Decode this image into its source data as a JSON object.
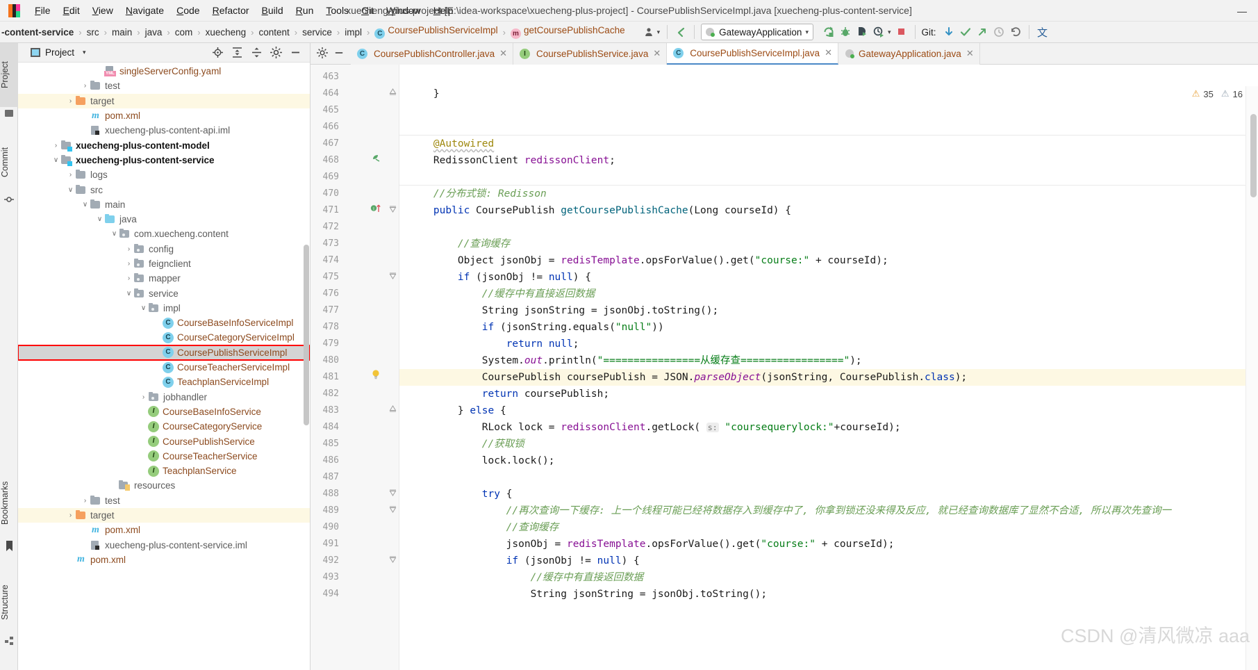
{
  "titlebar": {
    "app_icon": "intellij-logo-icon",
    "title": "xuecheng-plus-project [E:\\idea-workspace\\xuecheng-plus-project] - CoursePublishServiceImpl.java [xuecheng-plus-content-service]",
    "menus": [
      {
        "mnemonic": "F",
        "rest": "ile"
      },
      {
        "mnemonic": "E",
        "rest": "dit"
      },
      {
        "mnemonic": "V",
        "rest": "iew"
      },
      {
        "mnemonic": "N",
        "rest": "avigate"
      },
      {
        "mnemonic": "C",
        "rest": "ode"
      },
      {
        "mnemonic": "R",
        "rest": "efactor"
      },
      {
        "mnemonic": "B",
        "rest": "uild"
      },
      {
        "mnemonic": "R",
        "rest": "un"
      },
      {
        "mnemonic": "T",
        "rest": "ools"
      },
      {
        "mnemonic": "G",
        "rest": "it"
      },
      {
        "mnemonic": "W",
        "rest": "indow"
      },
      {
        "mnemonic": "H",
        "rest": "elp"
      }
    ],
    "minimize_label": "—"
  },
  "navbar": {
    "breadcrumb": [
      {
        "label": "-content-service",
        "kind": "module"
      },
      {
        "label": "src",
        "kind": "dir"
      },
      {
        "label": "main",
        "kind": "dir"
      },
      {
        "label": "java",
        "kind": "dir"
      },
      {
        "label": "com",
        "kind": "dir"
      },
      {
        "label": "xuecheng",
        "kind": "dir"
      },
      {
        "label": "content",
        "kind": "dir"
      },
      {
        "label": "service",
        "kind": "dir"
      },
      {
        "label": "impl",
        "kind": "dir"
      },
      {
        "label": "CoursePublishServiceImpl",
        "kind": "class"
      },
      {
        "label": "getCoursePublishCache",
        "kind": "method"
      }
    ],
    "run_config": "GatewayApplication",
    "git_label": "Git:",
    "icons": {
      "profile": "user-profile-icon",
      "back": "back-arrow-icon",
      "run": "run-icon",
      "debug": "debug-icon",
      "run_with_coverage": "run-coverage-icon",
      "profiler": "profiler-icon",
      "stop": "stop-icon",
      "update_project": "git-update-icon",
      "commit": "git-commit-icon",
      "push": "git-push-icon",
      "history": "git-history-icon",
      "rollback": "git-rollback-icon",
      "translate": "translate-icon"
    }
  },
  "left_strip": {
    "tabs": [
      {
        "label": "Project",
        "active": true,
        "icon": "project-icon"
      },
      {
        "label": "Commit",
        "active": false,
        "icon": "commit-icon"
      },
      {
        "label": "Bookmarks",
        "active": false,
        "icon": "bookmark-icon"
      },
      {
        "label": "Structure",
        "active": false,
        "icon": "structure-icon"
      }
    ]
  },
  "project_panel": {
    "title": "Project",
    "caret": "▾",
    "actions": [
      "locate-target-icon",
      "expand-all-icon",
      "collapse-all-icon",
      "settings-icon",
      "hide-icon"
    ],
    "tree": [
      {
        "indent": 5,
        "arrow": "",
        "icon": "yml-file",
        "label": "singleServerConfig.yaml",
        "style": "file"
      },
      {
        "indent": 4,
        "arrow": "›",
        "icon": "folder-gray",
        "label": "test",
        "style": "dir"
      },
      {
        "indent": 3,
        "arrow": "›",
        "icon": "folder-orange",
        "label": "target",
        "style": "dir",
        "highlight": "target"
      },
      {
        "indent": 4,
        "arrow": "",
        "icon": "maven-m",
        "label": "pom.xml",
        "style": "file"
      },
      {
        "indent": 4,
        "arrow": "",
        "icon": "iml-file",
        "label": "xuecheng-plus-content-api.iml",
        "style": "dirfile"
      },
      {
        "indent": 2,
        "arrow": "›",
        "icon": "folder-module",
        "label": "xuecheng-plus-content-model",
        "style": "module"
      },
      {
        "indent": 2,
        "arrow": "∨",
        "icon": "folder-module",
        "label": "xuecheng-plus-content-service",
        "style": "module"
      },
      {
        "indent": 3,
        "arrow": "›",
        "icon": "folder-gray",
        "label": "logs",
        "style": "dir"
      },
      {
        "indent": 3,
        "arrow": "∨",
        "icon": "folder-gray",
        "label": "src",
        "style": "dir"
      },
      {
        "indent": 4,
        "arrow": "∨",
        "icon": "folder-gray",
        "label": "main",
        "style": "dir"
      },
      {
        "indent": 5,
        "arrow": "∨",
        "icon": "folder-blue",
        "label": "java",
        "style": "dir"
      },
      {
        "indent": 6,
        "arrow": "∨",
        "icon": "folder-pkg",
        "label": "com.xuecheng.content",
        "style": "dir"
      },
      {
        "indent": 7,
        "arrow": "›",
        "icon": "folder-pkg",
        "label": "config",
        "style": "dir"
      },
      {
        "indent": 7,
        "arrow": "›",
        "icon": "folder-pkg",
        "label": "feignclient",
        "style": "dir"
      },
      {
        "indent": 7,
        "arrow": "›",
        "icon": "folder-pkg",
        "label": "mapper",
        "style": "dir"
      },
      {
        "indent": 7,
        "arrow": "∨",
        "icon": "folder-pkg",
        "label": "service",
        "style": "dir"
      },
      {
        "indent": 8,
        "arrow": "∨",
        "icon": "folder-pkg",
        "label": "impl",
        "style": "dir"
      },
      {
        "indent": 9,
        "arrow": "",
        "icon": "java-class",
        "label": "CourseBaseInfoServiceImpl",
        "style": "file"
      },
      {
        "indent": 9,
        "arrow": "",
        "icon": "java-class",
        "label": "CourseCategoryServiceImpl",
        "style": "file"
      },
      {
        "indent": 9,
        "arrow": "",
        "icon": "java-class",
        "label": "CoursePublishServiceImpl",
        "style": "file",
        "selected": true,
        "boxed": true
      },
      {
        "indent": 9,
        "arrow": "",
        "icon": "java-class",
        "label": "CourseTeacherServiceImpl",
        "style": "file"
      },
      {
        "indent": 9,
        "arrow": "",
        "icon": "java-class",
        "label": "TeachplanServiceImpl",
        "style": "file"
      },
      {
        "indent": 8,
        "arrow": "›",
        "icon": "folder-pkg",
        "label": "jobhandler",
        "style": "dir"
      },
      {
        "indent": 8,
        "arrow": "",
        "icon": "java-interface",
        "label": "CourseBaseInfoService",
        "style": "file"
      },
      {
        "indent": 8,
        "arrow": "",
        "icon": "java-interface",
        "label": "CourseCategoryService",
        "style": "file"
      },
      {
        "indent": 8,
        "arrow": "",
        "icon": "java-interface",
        "label": "CoursePublishService",
        "style": "file"
      },
      {
        "indent": 8,
        "arrow": "",
        "icon": "java-interface",
        "label": "CourseTeacherService",
        "style": "file"
      },
      {
        "indent": 8,
        "arrow": "",
        "icon": "java-interface",
        "label": "TeachplanService",
        "style": "file"
      },
      {
        "indent": 6,
        "arrow": "",
        "icon": "folder-resources",
        "label": "resources",
        "style": "dir"
      },
      {
        "indent": 4,
        "arrow": "›",
        "icon": "folder-gray",
        "label": "test",
        "style": "dir"
      },
      {
        "indent": 3,
        "arrow": "›",
        "icon": "folder-orange",
        "label": "target",
        "style": "dir",
        "highlight": "target"
      },
      {
        "indent": 4,
        "arrow": "",
        "icon": "maven-m",
        "label": "pom.xml",
        "style": "file"
      },
      {
        "indent": 4,
        "arrow": "",
        "icon": "iml-file",
        "label": "xuecheng-plus-content-service.iml",
        "style": "dirfile"
      },
      {
        "indent": 3,
        "arrow": "",
        "icon": "maven-m",
        "label": "pom.xml",
        "style": "file"
      }
    ]
  },
  "editor": {
    "tabs": [
      {
        "label": "CoursePublishController.java",
        "icon": "java-class",
        "active": false
      },
      {
        "label": "CoursePublishService.java",
        "icon": "java-interface",
        "active": false
      },
      {
        "label": "CoursePublishServiceImpl.java",
        "icon": "java-class",
        "active": true
      },
      {
        "label": "GatewayApplication.java",
        "icon": "spring-boot",
        "active": false
      }
    ],
    "tab_tools": [
      "settings-icon",
      "hide-icon"
    ],
    "inspections": {
      "warnings": "35",
      "weak_warnings": "16"
    },
    "first_line_number": 463,
    "lines": [
      {
        "n": 463,
        "text": ""
      },
      {
        "n": 464,
        "text": "    }",
        "fold": "end"
      },
      {
        "n": 465,
        "text": ""
      },
      {
        "n": 466,
        "text": ""
      },
      {
        "n": 467,
        "text": "    @Autowired",
        "sep_above": true
      },
      {
        "n": 468,
        "text": "    RedissonClient redissonClient;",
        "gicon": "bean-icon"
      },
      {
        "n": 469,
        "text": ""
      },
      {
        "n": 470,
        "text": "    //分布式锁: Redisson",
        "sep_above": true
      },
      {
        "n": 471,
        "text": "    public CoursePublish getCoursePublishCache(Long courseId) {",
        "gicon": "override-icon",
        "fold": "start"
      },
      {
        "n": 472,
        "text": ""
      },
      {
        "n": 473,
        "text": "        //查询缓存"
      },
      {
        "n": 474,
        "text": "        Object jsonObj = redisTemplate.opsForValue().get(\"course:\" + courseId);"
      },
      {
        "n": 475,
        "text": "        if (jsonObj != null) {",
        "fold": "start"
      },
      {
        "n": 476,
        "text": "            //缓存中有直接返回数据"
      },
      {
        "n": 477,
        "text": "            String jsonString = jsonObj.toString();"
      },
      {
        "n": 478,
        "text": "            if (jsonString.equals(\"null\"))"
      },
      {
        "n": 479,
        "text": "                return null;"
      },
      {
        "n": 480,
        "text": "            System.out.println(\"================从缓存查=================\");"
      },
      {
        "n": 481,
        "text": "            CoursePublish coursePublish = JSON.parseObject(jsonString, CoursePublish.class);",
        "highlight": true,
        "gicon": "intention-bulb-icon"
      },
      {
        "n": 482,
        "text": "            return coursePublish;"
      },
      {
        "n": 483,
        "text": "        } else {",
        "fold": "end"
      },
      {
        "n": 484,
        "text": "            RLock lock = redissonClient.getLock( s: \"coursequerylock:\"+courseId);"
      },
      {
        "n": 485,
        "text": "            //获取锁"
      },
      {
        "n": 486,
        "text": "            lock.lock();"
      },
      {
        "n": 487,
        "text": ""
      },
      {
        "n": 488,
        "text": "            try {",
        "fold": "start"
      },
      {
        "n": 489,
        "text": "                //再次查询一下缓存: 上一个线程可能已经将数据存入到缓存中了, 你拿到锁还没来得及反应, 就已经查询数据库了显然不合适, 所以再次先查询一",
        "fold": "start"
      },
      {
        "n": 490,
        "text": "                //查询缓存"
      },
      {
        "n": 491,
        "text": "                jsonObj = redisTemplate.opsForValue().get(\"course:\" + courseId);"
      },
      {
        "n": 492,
        "text": "                if (jsonObj != null) {",
        "fold": "start"
      },
      {
        "n": 493,
        "text": "                    //缓存中有直接返回数据"
      },
      {
        "n": 494,
        "text": "                    String jsonString = jsonObj.toString();"
      }
    ]
  },
  "watermark": "CSDN @清风微凉 aaa",
  "colors": {
    "accent": "#4a88c7",
    "keyword": "#0033b3",
    "string": "#067d17",
    "comment": "#6a9e55",
    "field": "#871094",
    "method": "#00627a",
    "annotation": "#9e880d",
    "highlight_line": "#fdf8e3",
    "selection_box": "#ff0000"
  }
}
